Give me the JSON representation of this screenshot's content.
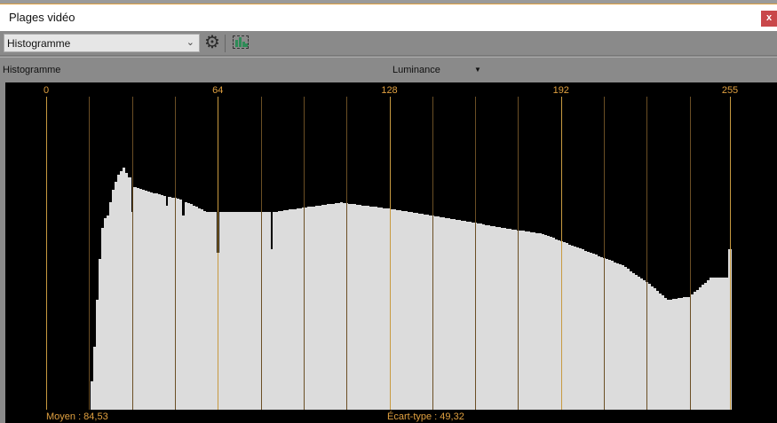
{
  "window": {
    "title": "Plages vidéo",
    "close_label": "x"
  },
  "toolbar": {
    "view_select": "Histogramme"
  },
  "header": {
    "label": "Histogramme",
    "channel": "Luminance"
  },
  "colors": {
    "accent": "#e0a040",
    "bars": "#dcdcdc",
    "close": "#c9474a"
  },
  "chart_data": {
    "type": "bar",
    "title": "Histogramme",
    "channel": "Luminance",
    "xlim": [
      0,
      255
    ],
    "ylim": [
      0,
      100
    ],
    "x_ticks": [
      0,
      64,
      128,
      192,
      255
    ],
    "grid_step": 16,
    "value_unit": "relative count (% of plot height)",
    "keypoints": [
      [
        0,
        0
      ],
      [
        16,
        0
      ],
      [
        17,
        9
      ],
      [
        18,
        20
      ],
      [
        19,
        35
      ],
      [
        20,
        48
      ],
      [
        21,
        58
      ],
      [
        22,
        61
      ],
      [
        23,
        62
      ],
      [
        24,
        66
      ],
      [
        25,
        70
      ],
      [
        27,
        75
      ],
      [
        29,
        77
      ],
      [
        31,
        74
      ],
      [
        33,
        71
      ],
      [
        40,
        69
      ],
      [
        50,
        67
      ],
      [
        60,
        63
      ],
      [
        64,
        63
      ],
      [
        85,
        63
      ],
      [
        110,
        66
      ],
      [
        128,
        64
      ],
      [
        150,
        61
      ],
      [
        170,
        58
      ],
      [
        185,
        56
      ],
      [
        200,
        51
      ],
      [
        215,
        46
      ],
      [
        225,
        40
      ],
      [
        232,
        35
      ],
      [
        240,
        36
      ],
      [
        248,
        42
      ],
      [
        254,
        42
      ],
      [
        255,
        51
      ]
    ],
    "spikes": [
      [
        32,
        63
      ],
      [
        45,
        65
      ],
      [
        51,
        62
      ],
      [
        64,
        50
      ],
      [
        84,
        51
      ]
    ],
    "stats": {
      "mean": "Moyen : 84,53",
      "stddev": "Écart-type : 49,32"
    }
  }
}
